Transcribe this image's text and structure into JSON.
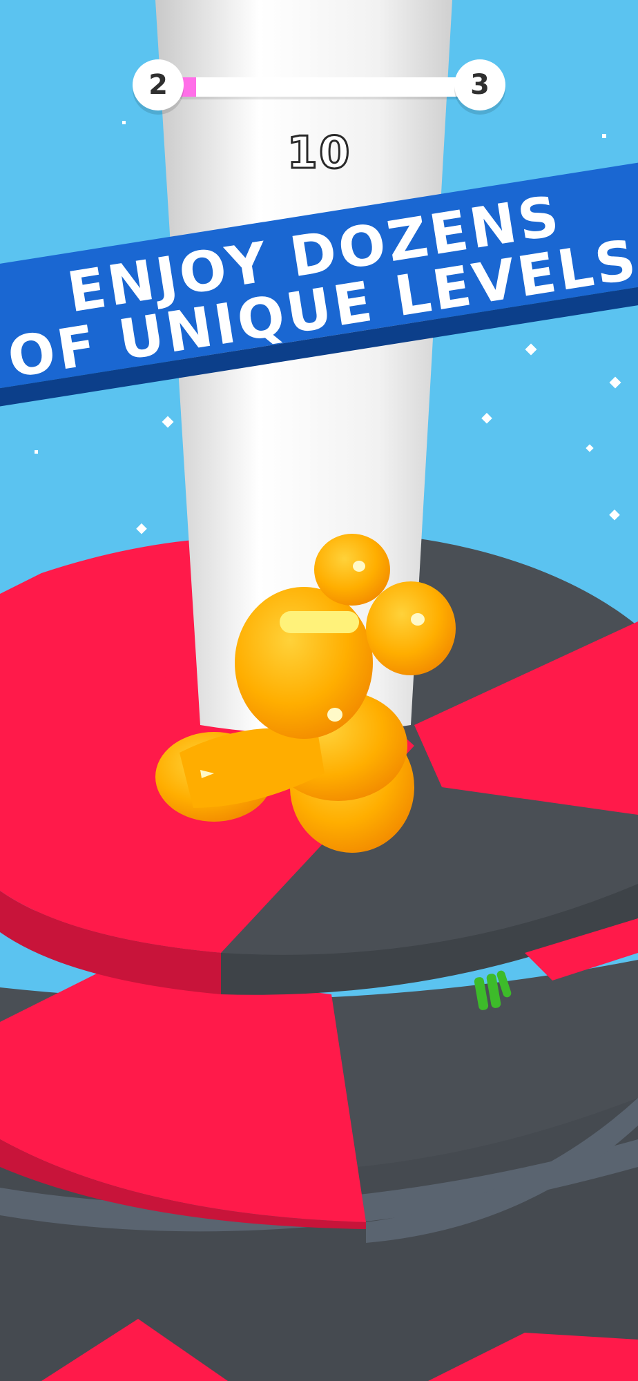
{
  "hud": {
    "current_level": "2",
    "next_level": "3",
    "level_progress": 0.06,
    "score": "10"
  },
  "promo_banner": {
    "line1": "ENJOY DOZENS",
    "line2": "OF UNIQUE LEVELS"
  },
  "colors": {
    "sky": "#5bc3f0",
    "tower": "#f1f1f1",
    "safe_platform": "#4a4f55",
    "danger_platform": "#ff1a4a",
    "ball": "#ffb000",
    "banner": "#1a67d2",
    "progress_fill": "#ff6ee8"
  },
  "scene": {
    "character": "orange-jelly-blob",
    "platform_segments": [
      "safe",
      "danger",
      "safe",
      "danger"
    ]
  }
}
